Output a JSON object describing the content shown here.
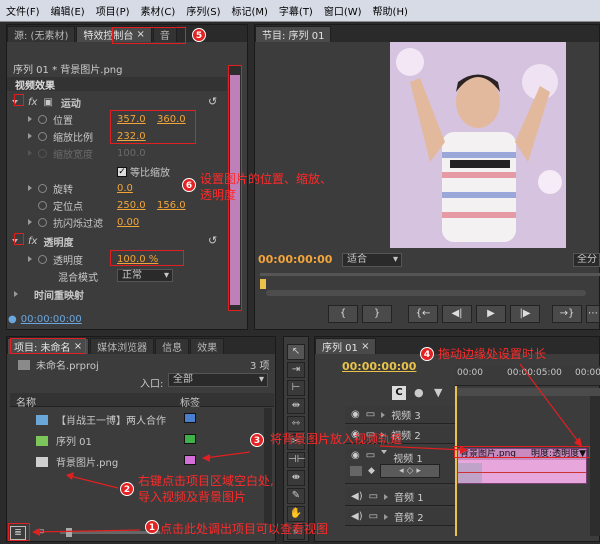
{
  "menu": [
    "文件(F)",
    "编辑(E)",
    "项目(P)",
    "素材(C)",
    "序列(S)",
    "标记(M)",
    "字幕(T)",
    "窗口(W)",
    "帮助(H)"
  ],
  "source_panel": {
    "tab_source": "源: (无素材)",
    "tab_effects_control": "特效控制台",
    "tab_extra": "音",
    "seq_label": "序列 01 * 背景图片.png",
    "video_effects": "视频效果",
    "motion": "运动",
    "position_label": "位置",
    "position_x": "357.0",
    "position_y": "360.0",
    "scale_label": "缩放比例",
    "scale_value": "232.0",
    "scale_width_label": "缩放宽度",
    "scale_width_value": "100.0",
    "uniform_scale": "等比缩放",
    "rotation_label": "旋转",
    "rotation_value": "0.0",
    "anchor_label": "定位点",
    "anchor_x": "250.0",
    "anchor_y": "156.0",
    "antiflicker_label": "抗闪烁过滤",
    "antiflicker_value": "0.00",
    "opacity_section": "透明度",
    "opacity_label": "透明度",
    "opacity_value": "100.0 %",
    "blend_label": "混合模式",
    "blend_value": "正常",
    "time_remap": "时间重映射",
    "timecode": "00:00:00:00"
  },
  "program_panel": {
    "tab": "节目: 序列 01",
    "timecode": "00:00:00:00",
    "fit": "适合",
    "full": "全分",
    "buttons": [
      "{",
      "}",
      "{←",
      "◀|",
      "▶",
      "|▶",
      "→}"
    ]
  },
  "project_panel": {
    "tab_project": "项目: 未命名",
    "tab_media": "媒体浏览器",
    "tab_info": "信息",
    "tab_effects": "效果",
    "count": "3 项",
    "filename": "未命名.prproj",
    "entry_label": "入口:",
    "entry_value": "全部",
    "col_name": "名称",
    "col_label": "标签",
    "items": [
      {
        "name": "【肖战王一博】两人合作",
        "color": "#4a7fd0"
      },
      {
        "name": "序列 01",
        "color": "#3fb04a"
      },
      {
        "name": "背景图片.png",
        "color": "#d46fd8"
      }
    ]
  },
  "timeline": {
    "tab": "序列 01",
    "timecode": "00:00:00:00",
    "ruler_start": "00:00",
    "ruler_mid": "00:00:05:00",
    "ruler_end": "00:00",
    "tracks": [
      {
        "name": "视频 3"
      },
      {
        "name": "视频 2"
      },
      {
        "name": "视频 1"
      },
      {
        "name": "音频 1"
      },
      {
        "name": "音频 2"
      }
    ],
    "clip_label": "背景图片.png",
    "clip_opacity": "明度:透明度▼"
  },
  "annotations": {
    "a1": "点击此处调出项目可以查看视图",
    "a2_line1": "右键点击项目区域空白处,",
    "a2_line2": "导入视频及背景图片",
    "a3": "将背景图片放入视频轨道",
    "a4": "拖动边缘处设置时长",
    "a6_line1": "设置图片的位置、缩放、",
    "a6_line2": "透明度",
    "n1": "1",
    "n2": "2",
    "n3": "3",
    "n4": "4",
    "n5": "5",
    "n6": "6"
  },
  "colors": {
    "accent": "#f2a53a",
    "annotation_red": "#e02020",
    "clip_pink": "#e7a6dc"
  }
}
